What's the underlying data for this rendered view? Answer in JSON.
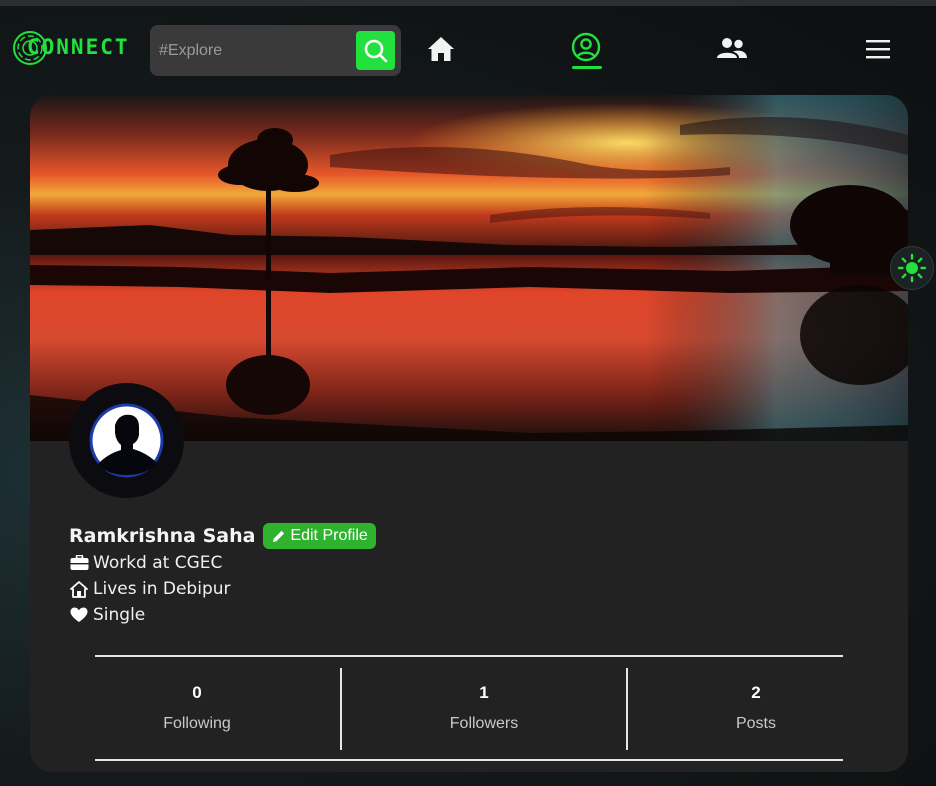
{
  "brand": {
    "name": "CONNECT",
    "accent": "#22e03d"
  },
  "search": {
    "placeholder": "#Explore"
  },
  "nav": {
    "items": [
      {
        "icon": "home-icon",
        "active": false
      },
      {
        "icon": "user-circle-icon",
        "active": true
      },
      {
        "icon": "users-icon",
        "active": false
      },
      {
        "icon": "hamburger-menu-icon",
        "active": false
      }
    ]
  },
  "profile": {
    "name": "Ramkrishna Saha",
    "edit_label": "Edit Profile",
    "info": [
      {
        "icon": "briefcase-icon",
        "text": "Workd at CGEC"
      },
      {
        "icon": "house-icon",
        "text": "Lives in Debipur"
      },
      {
        "icon": "heart-icon",
        "text": "Single"
      }
    ]
  },
  "stats": [
    {
      "value": "0",
      "label": "Following"
    },
    {
      "value": "1",
      "label": "Followers"
    },
    {
      "value": "2",
      "label": "Posts"
    }
  ],
  "theme_toggle": {
    "icon": "sun-icon"
  }
}
